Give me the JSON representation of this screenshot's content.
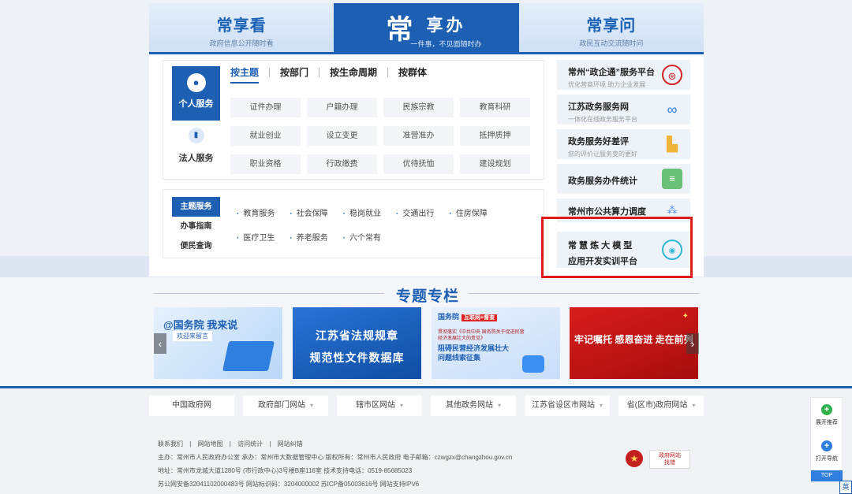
{
  "header": {
    "tabs": [
      {
        "title": "常享看",
        "subtitle": "政府信息公开随时看"
      },
      {
        "big": "常",
        "title": "享办",
        "subtitle": "一件事，不见面随时办"
      },
      {
        "title": "常享问",
        "subtitle": "政民互动交流随时问"
      }
    ]
  },
  "services": {
    "side": [
      {
        "label": "个人服务",
        "icon": "person-icon"
      },
      {
        "label": "法人服务",
        "icon": "building-icon"
      }
    ],
    "category_tabs": [
      "按主题",
      "按部门",
      "按生命周期",
      "按群体"
    ],
    "grid": [
      "证件办理",
      "户籍办理",
      "民族宗教",
      "教育科研",
      "就业创业",
      "设立变更",
      "准营准办",
      "抵押质押",
      "职业资格",
      "行政缴费",
      "优待抚恤",
      "建设规划"
    ]
  },
  "topics": {
    "side": [
      "主题服务",
      "办事指南",
      "便民查询"
    ],
    "items": [
      "教育服务",
      "社会保障",
      "稳岗就业",
      "交通出行",
      "住房保障",
      "医疗卫生",
      "养老服务",
      "六个常有"
    ]
  },
  "right_cards": [
    {
      "title": "常州“政企通”服务平台",
      "subtitle": "优化营商环境 助力企业发展",
      "icon": "seal-icon",
      "color": "#d12727"
    },
    {
      "title": "江苏政务服务网",
      "subtitle": "一体化在线政务服务平台",
      "icon": "ring-logo-icon",
      "color": "#2f7fe0"
    },
    {
      "title": "政务服务好差评",
      "subtitle": "您的评价让服务变的更好",
      "icon": "thumbs-up-icon",
      "color": "#f0b43a"
    },
    {
      "title": "政务服务办件统计",
      "subtitle": "",
      "icon": "clipboard-icon",
      "color": "#69c076"
    },
    {
      "title": "常州市公共算力调度",
      "subtitle": "",
      "icon": "network-icon",
      "color": "#4d8de8"
    },
    {
      "title": "常 慧 炼 大 模 型",
      "title2": "应用开发实训平台",
      "icon": "ai-logo-icon",
      "color": "#2fb7d6"
    }
  ],
  "special": {
    "title": "专题专栏",
    "banners": [
      {
        "title": "@国务院 我来说",
        "sub": "欢迎来留言"
      },
      {
        "line1": "江苏省法规规章",
        "line2": "规范性文件数据库"
      },
      {
        "head": "国务院",
        "tag": "互联网+督查",
        "desc": "贯彻落实《中共中央 国务院关于促进民营经济发展壮大的意见》",
        "main1": "阻碍民营经济发展壮大",
        "main2": "问题线索征集"
      },
      {
        "text": "牢记嘱托 感恩奋进 走在前列"
      }
    ]
  },
  "footer": {
    "links": [
      "中国政府网",
      "政府部门网站",
      "辖市区网站",
      "其他政务网站",
      "江苏省设区市网站",
      "省(区市)政府网站"
    ],
    "nav": [
      "联系我们",
      "|",
      "网站地图",
      "|",
      "访问统计",
      "|",
      "网站纠错"
    ],
    "line1": "主办：常州市人民政府办公室   承办：常州市大数据管理中心   版权所有：常州市人民政府   电子邮箱：czwgzx@changzhou.gov.cn",
    "line2": "地址：常州市龙城大道1280号 (市行政中心)3号楼B座116室   技术支持电话：0519-85685023",
    "line3": "苏公网安备32041102000483号   网站标识码：3204000002   苏ICP备05003616号   网站支持IPV6",
    "correct_top": "政府网站",
    "correct_bottom": "找错"
  },
  "float": {
    "expand": "展开推荐",
    "guide": "打开导航",
    "top": "TOP"
  },
  "lang": "英"
}
